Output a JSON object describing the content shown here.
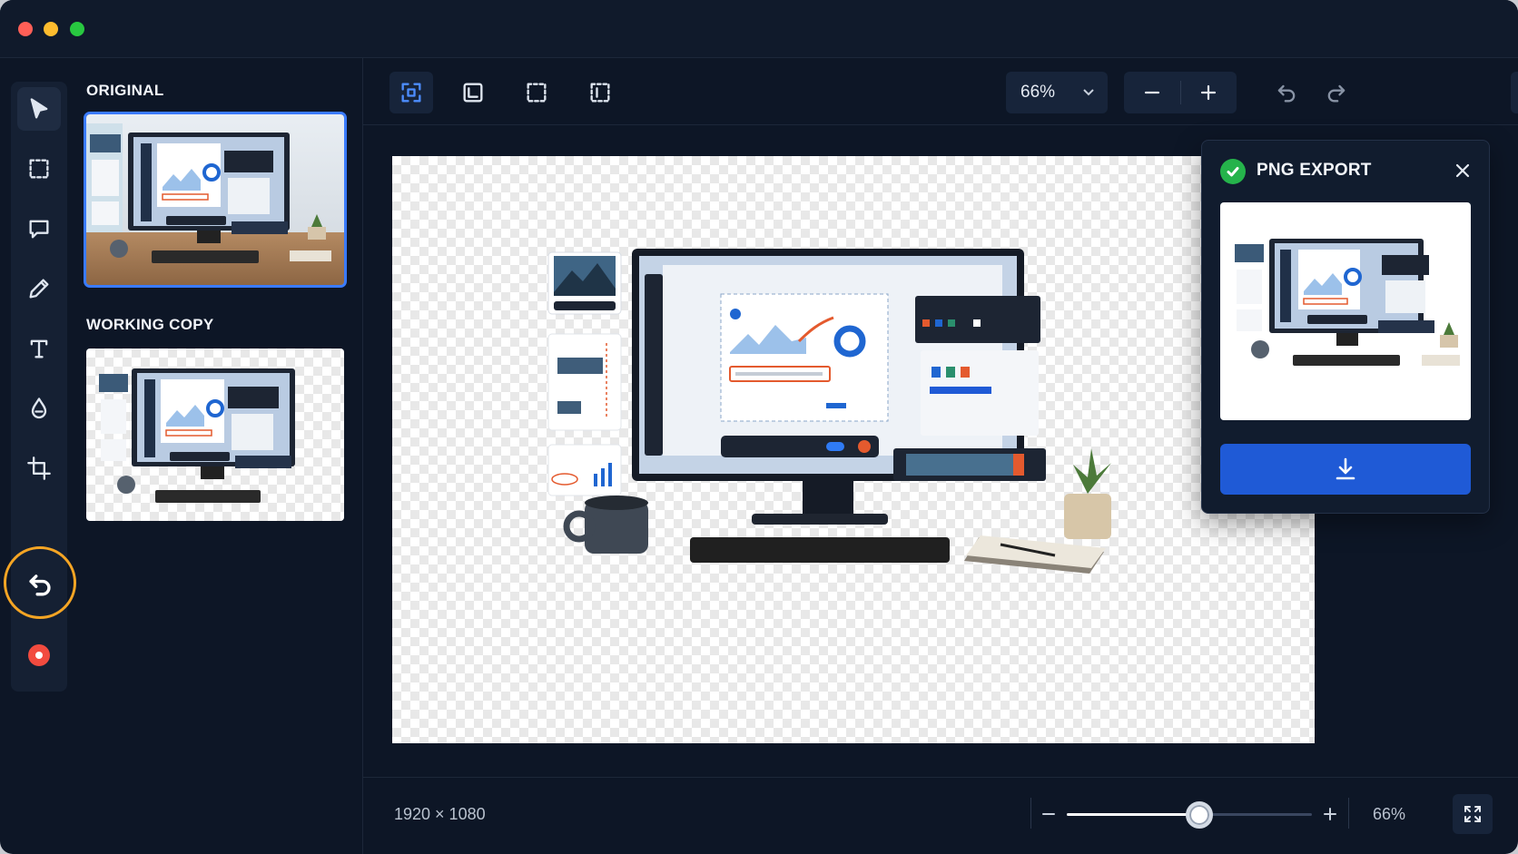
{
  "window": {
    "controls": [
      "close",
      "minimize",
      "maximize"
    ]
  },
  "rail": {
    "tools": [
      {
        "name": "select-tool",
        "icon": "cursor-icon"
      },
      {
        "name": "marquee-tool",
        "icon": "dashed-rect-icon"
      },
      {
        "name": "comment-tool",
        "icon": "speech-bubble-icon"
      },
      {
        "name": "pen-tool",
        "icon": "pencil-icon"
      },
      {
        "name": "text-tool",
        "icon": "text-icon"
      },
      {
        "name": "fill-tool",
        "icon": "drop-icon"
      },
      {
        "name": "crop-tool",
        "icon": "crop-icon"
      },
      {
        "name": "undo-tool",
        "icon": "undo-icon"
      },
      {
        "name": "record-tool",
        "icon": "record-icon"
      }
    ],
    "highlight_color": "#f5a524"
  },
  "thumbs": {
    "original_label": "ORIGINAL",
    "working_label": "WORKING COPY"
  },
  "toolbar": {
    "zoom_value": "66%",
    "accent_color": "#4d8dff",
    "arrow_color": "#ff6a3d"
  },
  "export": {
    "title": "PNG EXPORT",
    "download_color": "#1f5ad6"
  },
  "status": {
    "dimensions": "1920 × 1080",
    "zoom_percent": "66%",
    "zoom_slider_fraction": 0.54
  }
}
